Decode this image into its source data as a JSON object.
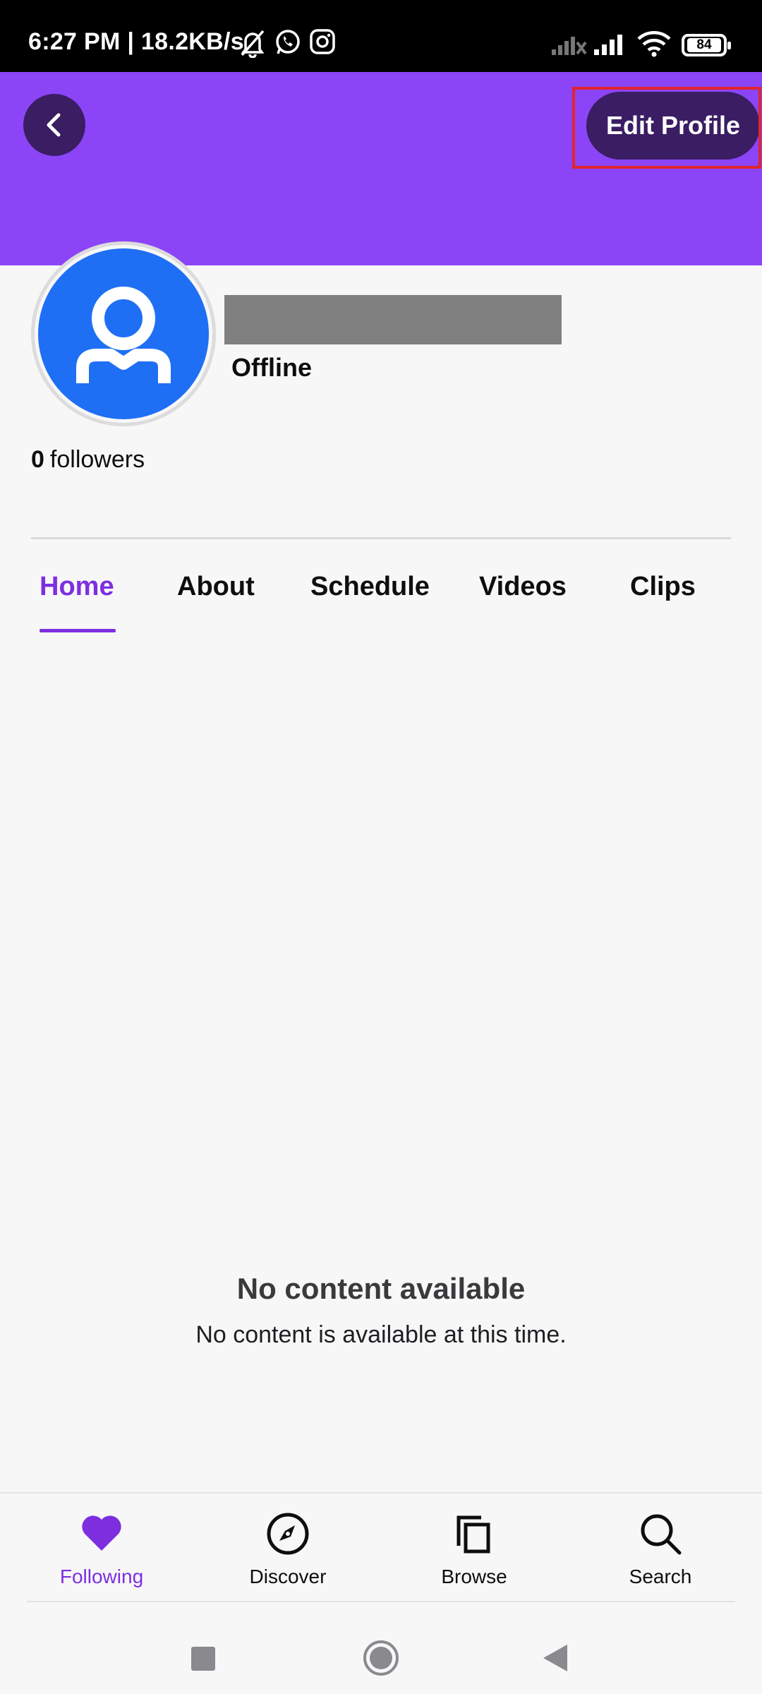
{
  "status_bar": {
    "time": "6:27 PM | 18.2KB/s",
    "battery": "84",
    "icons": [
      "mute-icon",
      "whatsapp-icon",
      "instagram-icon",
      "signal-off-icon",
      "signal-icon",
      "wifi-icon",
      "battery-icon"
    ]
  },
  "header": {
    "edit_profile_label": "Edit Profile",
    "banner_color": "#8c44f7",
    "button_color": "#3a1d63"
  },
  "profile": {
    "status": "Offline",
    "followers_count": "0",
    "followers_label": "followers"
  },
  "tabs": [
    {
      "label": "Home",
      "active": true
    },
    {
      "label": "About",
      "active": false
    },
    {
      "label": "Schedule",
      "active": false
    },
    {
      "label": "Videos",
      "active": false
    },
    {
      "label": "Clips",
      "active": false
    }
  ],
  "empty_state": {
    "title": "No content available",
    "subtitle": "No content is available at this time."
  },
  "bottom_nav": [
    {
      "label": "Following",
      "icon": "heart-icon",
      "active": true
    },
    {
      "label": "Discover",
      "icon": "compass-icon",
      "active": false
    },
    {
      "label": "Browse",
      "icon": "browse-icon",
      "active": false
    },
    {
      "label": "Search",
      "icon": "search-icon",
      "active": false
    }
  ],
  "colors": {
    "accent": "#7d2fe0",
    "avatar": "#1f6ff5",
    "highlight": "#e0242e"
  }
}
